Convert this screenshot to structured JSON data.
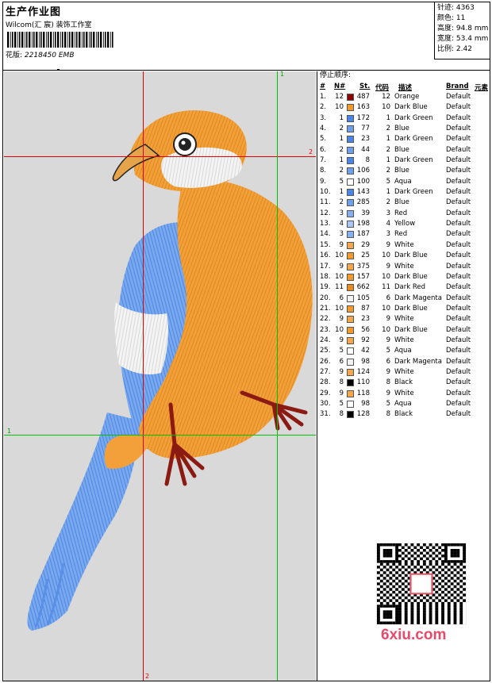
{
  "header": {
    "title": "生产作业图",
    "company": "Wilcom(汇 宸) 装饰工作室",
    "design_label": "花版:",
    "design_file": "2218450 EMB"
  },
  "info": [
    {
      "label": "针迹:",
      "value": "4363"
    },
    {
      "label": "颜色:",
      "value": "11"
    },
    {
      "label": "高度:",
      "value": "94.8 mm"
    },
    {
      "label": "宽度:",
      "value": "53.4 mm"
    },
    {
      "label": "比例:",
      "value": "2.42"
    }
  ],
  "canvas": {
    "guide_label_1": "1",
    "guide_label_2": "2"
  },
  "stops": {
    "title": "停止顺序:",
    "columns": {
      "idx": "#",
      "needle": "N#",
      "st": "St.",
      "code": "代码",
      "desc": "描述",
      "brand": "Brand",
      "element": "元素"
    },
    "rows": [
      {
        "idx": "1.",
        "needle": "12",
        "color": "#8b0000",
        "st": "487",
        "code": "12",
        "desc": "Orange",
        "brand": "Default"
      },
      {
        "idx": "2.",
        "needle": "10",
        "color": "#f39a2a",
        "st": "163",
        "code": "10",
        "desc": "Dark Blue",
        "brand": "Default"
      },
      {
        "idx": "3.",
        "needle": "1",
        "color": "#4a86e8",
        "st": "172",
        "code": "1",
        "desc": "Dark Green",
        "brand": "Default"
      },
      {
        "idx": "4.",
        "needle": "2",
        "color": "#6fa0ee",
        "st": "77",
        "code": "2",
        "desc": "Blue",
        "brand": "Default"
      },
      {
        "idx": "5.",
        "needle": "1",
        "color": "#4a86e8",
        "st": "23",
        "code": "1",
        "desc": "Dark Green",
        "brand": "Default"
      },
      {
        "idx": "6.",
        "needle": "2",
        "color": "#6fa0ee",
        "st": "44",
        "code": "2",
        "desc": "Blue",
        "brand": "Default"
      },
      {
        "idx": "7.",
        "needle": "1",
        "color": "#4a86e8",
        "st": "8",
        "code": "1",
        "desc": "Dark Green",
        "brand": "Default"
      },
      {
        "idx": "8.",
        "needle": "2",
        "color": "#6fa0ee",
        "st": "106",
        "code": "2",
        "desc": "Blue",
        "brand": "Default"
      },
      {
        "idx": "9.",
        "needle": "5",
        "color": "#ffffff",
        "st": "100",
        "code": "5",
        "desc": "Aqua",
        "brand": "Default"
      },
      {
        "idx": "10.",
        "needle": "1",
        "color": "#4a86e8",
        "st": "143",
        "code": "1",
        "desc": "Dark Green",
        "brand": "Default"
      },
      {
        "idx": "11.",
        "needle": "2",
        "color": "#6fa0ee",
        "st": "285",
        "code": "2",
        "desc": "Blue",
        "brand": "Default"
      },
      {
        "idx": "12.",
        "needle": "3",
        "color": "#87b0f2",
        "st": "39",
        "code": "3",
        "desc": "Red",
        "brand": "Default"
      },
      {
        "idx": "13.",
        "needle": "4",
        "color": "#a9c6f6",
        "st": "198",
        "code": "4",
        "desc": "Yellow",
        "brand": "Default"
      },
      {
        "idx": "14.",
        "needle": "3",
        "color": "#87b0f2",
        "st": "187",
        "code": "3",
        "desc": "Red",
        "brand": "Default"
      },
      {
        "idx": "15.",
        "needle": "9",
        "color": "#f7a64a",
        "st": "29",
        "code": "9",
        "desc": "White",
        "brand": "Default"
      },
      {
        "idx": "16.",
        "needle": "10",
        "color": "#f39a2a",
        "st": "25",
        "code": "10",
        "desc": "Dark Blue",
        "brand": "Default"
      },
      {
        "idx": "17.",
        "needle": "9",
        "color": "#f7a64a",
        "st": "375",
        "code": "9",
        "desc": "White",
        "brand": "Default"
      },
      {
        "idx": "18.",
        "needle": "10",
        "color": "#f39a2a",
        "st": "157",
        "code": "10",
        "desc": "Dark Blue",
        "brand": "Default"
      },
      {
        "idx": "19.",
        "needle": "11",
        "color": "#e88a1c",
        "st": "662",
        "code": "11",
        "desc": "Dark Red",
        "brand": "Default"
      },
      {
        "idx": "20.",
        "needle": "6",
        "color": "#f2f2f2",
        "st": "105",
        "code": "6",
        "desc": "Dark Magenta",
        "brand": "Default"
      },
      {
        "idx": "21.",
        "needle": "10",
        "color": "#f39a2a",
        "st": "87",
        "code": "10",
        "desc": "Dark Blue",
        "brand": "Default"
      },
      {
        "idx": "22.",
        "needle": "9",
        "color": "#f7a64a",
        "st": "23",
        "code": "9",
        "desc": "White",
        "brand": "Default"
      },
      {
        "idx": "23.",
        "needle": "10",
        "color": "#f39a2a",
        "st": "56",
        "code": "10",
        "desc": "Dark Blue",
        "brand": "Default"
      },
      {
        "idx": "24.",
        "needle": "9",
        "color": "#f7a64a",
        "st": "92",
        "code": "9",
        "desc": "White",
        "brand": "Default"
      },
      {
        "idx": "25.",
        "needle": "5",
        "color": "#ffffff",
        "st": "42",
        "code": "5",
        "desc": "Aqua",
        "brand": "Default"
      },
      {
        "idx": "26.",
        "needle": "6",
        "color": "#f2f2f2",
        "st": "98",
        "code": "6",
        "desc": "Dark Magenta",
        "brand": "Default"
      },
      {
        "idx": "27.",
        "needle": "9",
        "color": "#f7a64a",
        "st": "124",
        "code": "9",
        "desc": "White",
        "brand": "Default"
      },
      {
        "idx": "28.",
        "needle": "8",
        "color": "#000000",
        "st": "110",
        "code": "8",
        "desc": "Black",
        "brand": "Default"
      },
      {
        "idx": "29.",
        "needle": "9",
        "color": "#f7a64a",
        "st": "118",
        "code": "9",
        "desc": "White",
        "brand": "Default"
      },
      {
        "idx": "30.",
        "needle": "5",
        "color": "#ffffff",
        "st": "98",
        "code": "5",
        "desc": "Aqua",
        "brand": "Default"
      },
      {
        "idx": "31.",
        "needle": "8",
        "color": "#000000",
        "st": "128",
        "code": "8",
        "desc": "Black",
        "brand": "Default"
      }
    ]
  },
  "watermark": "6xiu.com"
}
